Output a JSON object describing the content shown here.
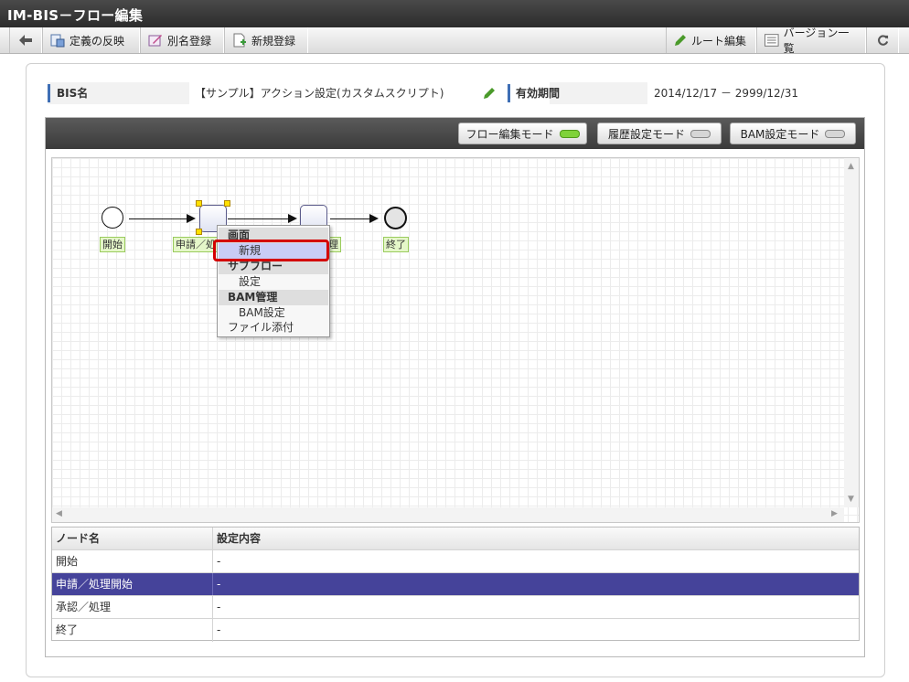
{
  "title": "IM-BIS－フロー編集",
  "toolbar": {
    "left": [
      "定義の反映",
      "別名登録",
      "新規登録"
    ],
    "right": [
      "ルート編集",
      "バージョン一覧"
    ]
  },
  "info": {
    "bis_label": "BIS名",
    "bis_value": "【サンプル】アクション設定(カスタムスクリプト)",
    "period_label": "有効期間",
    "period_value": "2014/12/17 － 2999/12/31"
  },
  "modes": [
    {
      "label": "フロー編集モード",
      "active": true
    },
    {
      "label": "履歴設定モード",
      "active": false
    },
    {
      "label": "BAM設定モード",
      "active": false
    }
  ],
  "flow": {
    "labels": {
      "start": "開始",
      "apply": "申請／処",
      "approve_tail": "理",
      "end": "終了"
    }
  },
  "context_menu": {
    "screen_header": "画面",
    "screen_new": "新規",
    "subflow_header": "サブフロー",
    "subflow_setting": "設定",
    "bam_header": "BAM管理",
    "bam_setting": "BAM設定",
    "file_attach": "ファイル添付"
  },
  "table": {
    "headers": [
      "ノード名",
      "設定内容"
    ],
    "rows": [
      {
        "name": "開始",
        "value": "-"
      },
      {
        "name": "申請／処理開始",
        "value": "-",
        "selected": true
      },
      {
        "name": "承認／処理",
        "value": "-"
      },
      {
        "name": "終了",
        "value": "-"
      }
    ]
  },
  "colors": {
    "accent": "#3f6fb5",
    "selected_row": "#45439a",
    "highlight_red": "#d40000",
    "active_led": "#7fd23a"
  }
}
